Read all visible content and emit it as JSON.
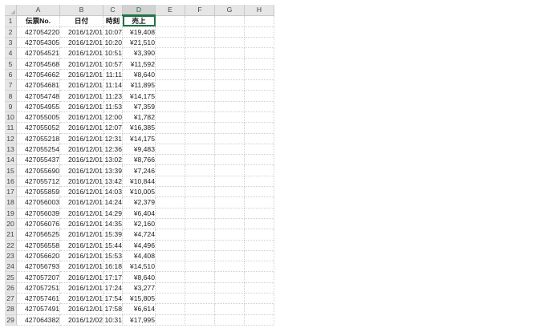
{
  "sheet": {
    "columns": [
      "A",
      "B",
      "C",
      "D",
      "E",
      "F",
      "G",
      "H"
    ],
    "active_column": "D",
    "accent_color": "#217346",
    "headers": [
      "伝票No.",
      "日付",
      "時刻",
      "売上"
    ],
    "rows": [
      [
        "427054220",
        "2016/12/01",
        "10:07",
        "¥19,408"
      ],
      [
        "427054305",
        "2016/12/01",
        "10:20",
        "¥21,510"
      ],
      [
        "427054521",
        "2016/12/01",
        "10:51",
        "¥3,390"
      ],
      [
        "427054568",
        "2016/12/01",
        "10:57",
        "¥11,592"
      ],
      [
        "427054662",
        "2016/12/01",
        "11:11",
        "¥8,640"
      ],
      [
        "427054681",
        "2016/12/01",
        "11:14",
        "¥11,895"
      ],
      [
        "427054748",
        "2016/12/01",
        "11:23",
        "¥14,175"
      ],
      [
        "427054955",
        "2016/12/01",
        "11:53",
        "¥7,359"
      ],
      [
        "427055005",
        "2016/12/01",
        "12:00",
        "¥1,782"
      ],
      [
        "427055052",
        "2016/12/01",
        "12:07",
        "¥16,385"
      ],
      [
        "427055218",
        "2016/12/01",
        "12:31",
        "¥14,175"
      ],
      [
        "427055254",
        "2016/12/01",
        "12:36",
        "¥9,483"
      ],
      [
        "427055437",
        "2016/12/01",
        "13:02",
        "¥8,766"
      ],
      [
        "427055690",
        "2016/12/01",
        "13:39",
        "¥7,246"
      ],
      [
        "427055712",
        "2016/12/01",
        "13:42",
        "¥10,844"
      ],
      [
        "427055859",
        "2016/12/01",
        "14:03",
        "¥10,005"
      ],
      [
        "427056003",
        "2016/12/01",
        "14:24",
        "¥2,379"
      ],
      [
        "427056039",
        "2016/12/01",
        "14:29",
        "¥6,404"
      ],
      [
        "427056076",
        "2016/12/01",
        "14:35",
        "¥2,160"
      ],
      [
        "427056525",
        "2016/12/01",
        "15:39",
        "¥4,724"
      ],
      [
        "427056558",
        "2016/12/01",
        "15:44",
        "¥4,496"
      ],
      [
        "427056620",
        "2016/12/01",
        "15:53",
        "¥4,408"
      ],
      [
        "427056793",
        "2016/12/01",
        "16:18",
        "¥14,510"
      ],
      [
        "427057207",
        "2016/12/01",
        "17:17",
        "¥8,640"
      ],
      [
        "427057251",
        "2016/12/01",
        "17:24",
        "¥3,277"
      ],
      [
        "427057461",
        "2016/12/01",
        "17:54",
        "¥15,805"
      ],
      [
        "427057491",
        "2016/12/01",
        "17:58",
        "¥6,614"
      ],
      [
        "427064382",
        "2016/12/02",
        "10:31",
        "¥17,995"
      ]
    ]
  }
}
